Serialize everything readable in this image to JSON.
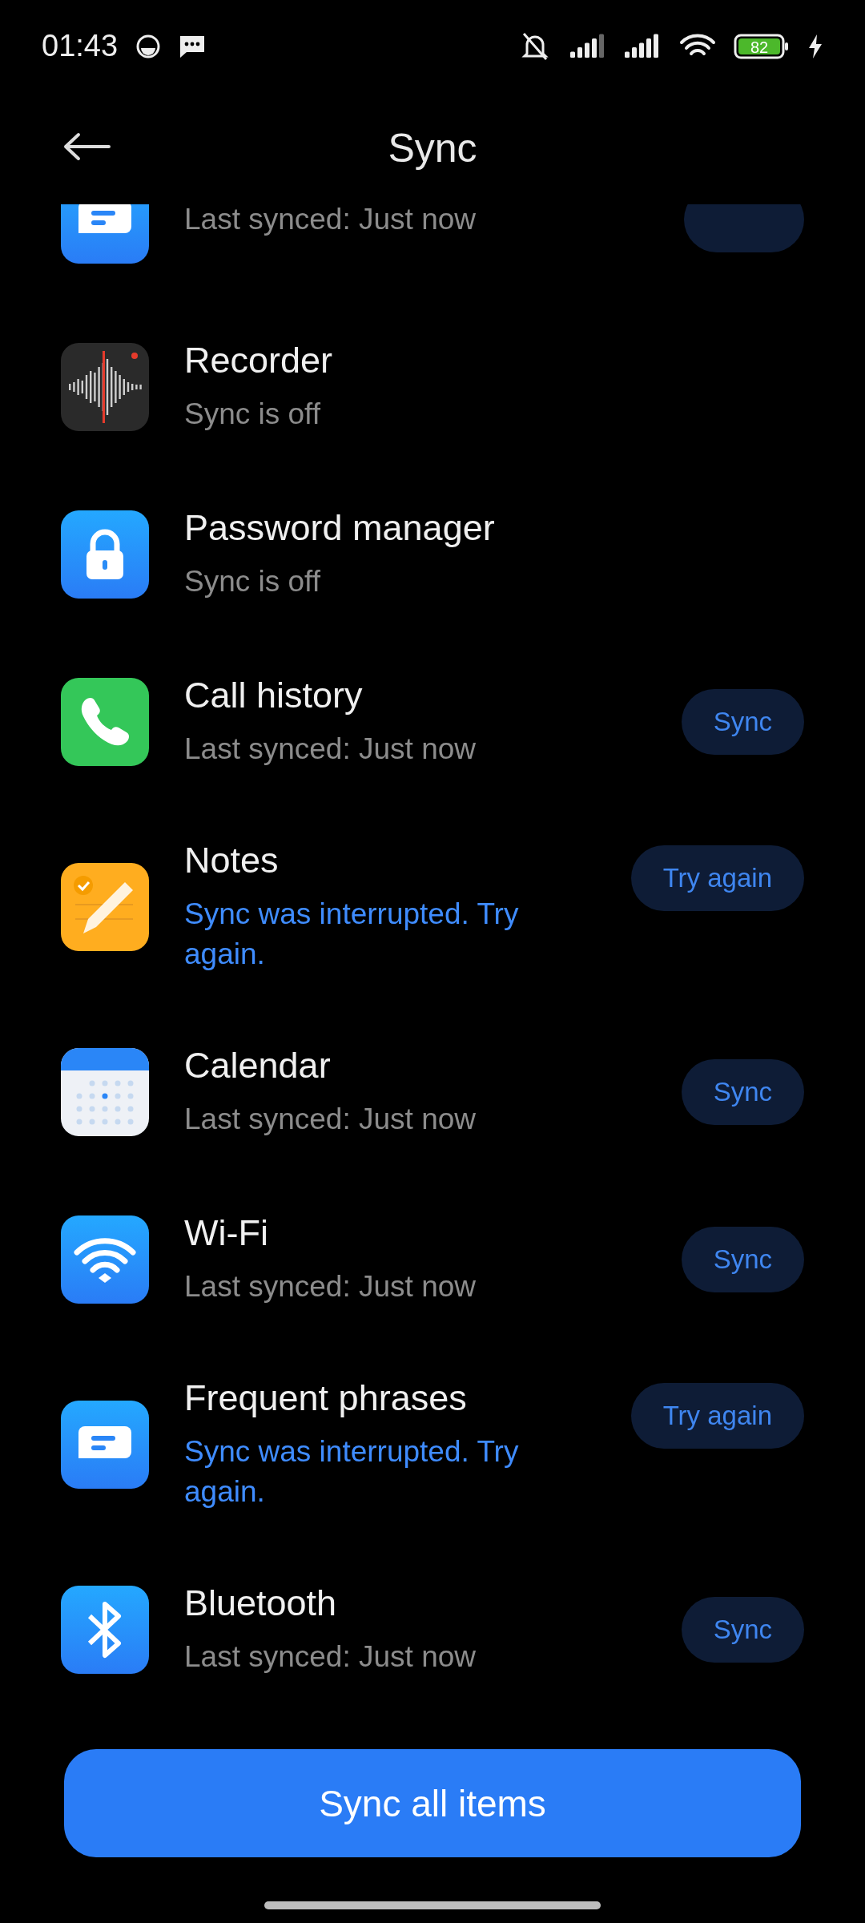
{
  "status_bar": {
    "time": "01:43",
    "battery": "82"
  },
  "header": {
    "title": "Sync"
  },
  "items": [
    {
      "subtitle": "Last synced: Just now",
      "interrupted": false,
      "button": true
    },
    {
      "title": "Recorder",
      "subtitle": "Sync is off",
      "interrupted": false,
      "button": false
    },
    {
      "title": "Password manager",
      "subtitle": "Sync is off",
      "interrupted": false,
      "button": false
    },
    {
      "title": "Call history",
      "subtitle": "Last synced: Just now",
      "interrupted": false,
      "button": true,
      "button_label": "Sync"
    },
    {
      "title": "Notes",
      "subtitle": "Sync was interrupted. Try again.",
      "interrupted": true,
      "button": true,
      "button_label": "Try again"
    },
    {
      "title": "Calendar",
      "subtitle": "Last synced: Just now",
      "interrupted": false,
      "button": true,
      "button_label": "Sync"
    },
    {
      "title": "Wi-Fi",
      "subtitle": "Last synced: Just now",
      "interrupted": false,
      "button": true,
      "button_label": "Sync"
    },
    {
      "title": "Frequent phrases",
      "subtitle": "Sync was interrupted. Try again.",
      "interrupted": true,
      "button": true,
      "button_label": "Try again"
    },
    {
      "title": "Bluetooth",
      "subtitle": "Last synced: Just now",
      "interrupted": false,
      "button": true,
      "button_label": "Sync"
    }
  ],
  "footer": {
    "button": "Sync all items"
  }
}
